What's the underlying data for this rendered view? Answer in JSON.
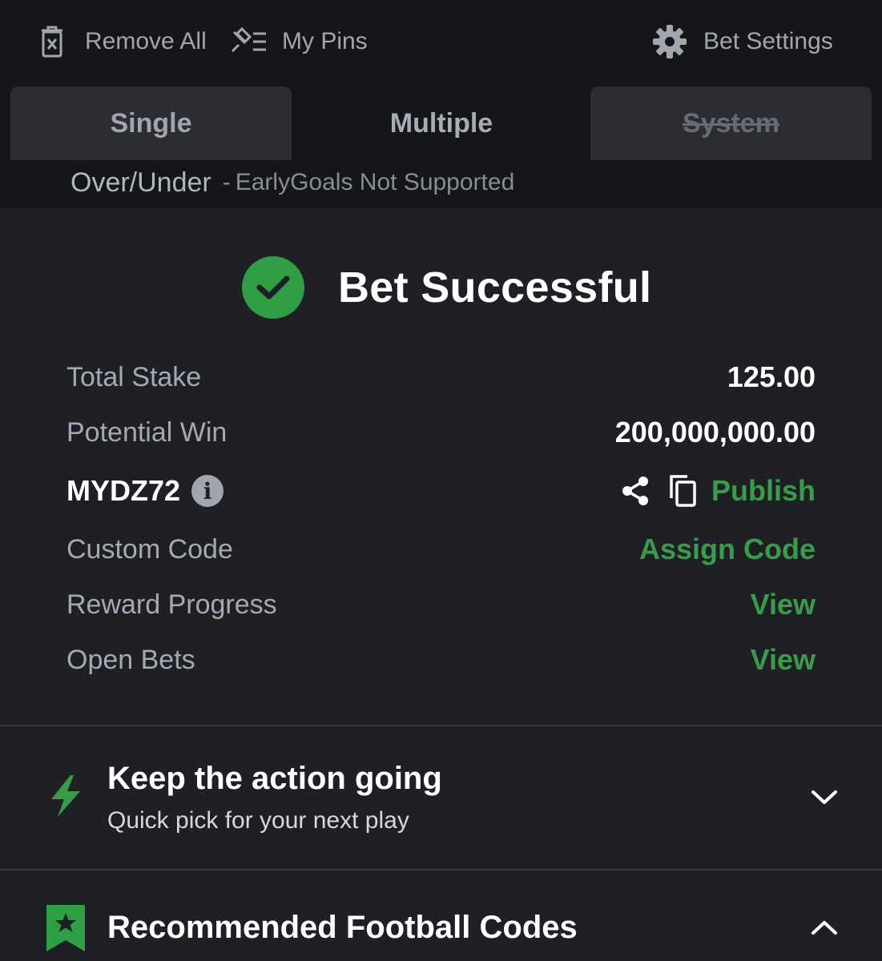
{
  "toolbar": {
    "remove_all": "Remove All",
    "my_pins": "My Pins",
    "bet_settings": "Bet Settings"
  },
  "tabs": {
    "single": "Single",
    "multiple": "Multiple",
    "system": "System",
    "active": "Multiple",
    "disabled": [
      "System"
    ]
  },
  "notice": {
    "market": "Over/Under",
    "separator": "-",
    "message": "EarlyGoals Not Supported"
  },
  "success": {
    "title": "Bet Successful",
    "total_stake_label": "Total Stake",
    "total_stake_value": "125.00",
    "potential_win_label": "Potential Win",
    "potential_win_value": "200,000,000.00",
    "booking_code": "MYDZ72",
    "info_glyph": "i",
    "publish_label": "Publish",
    "custom_code_label": "Custom Code",
    "assign_code_label": "Assign Code",
    "reward_progress_label": "Reward Progress",
    "reward_view_label": "View",
    "open_bets_label": "Open Bets",
    "open_bets_view_label": "View"
  },
  "action": {
    "title": "Keep the action going",
    "subtitle": "Quick pick for your next play"
  },
  "recommended": {
    "title": "Recommended Football Codes"
  },
  "icons": {
    "remove_all": "trash-x-icon",
    "my_pins": "pin-list-icon",
    "bet_settings": "gear-icon",
    "success": "check-circle-icon",
    "info": "info-icon",
    "share": "share-icon",
    "copy": "copy-icon",
    "action": "lightning-icon",
    "recommended": "bookmark-star-icon",
    "expand": "chevron-down-icon",
    "collapse": "chevron-up-icon"
  },
  "colors": {
    "accent_green": "#3a9b4a",
    "success_green": "#2f9e44",
    "background": "#1f2025",
    "header_background": "#151619"
  }
}
